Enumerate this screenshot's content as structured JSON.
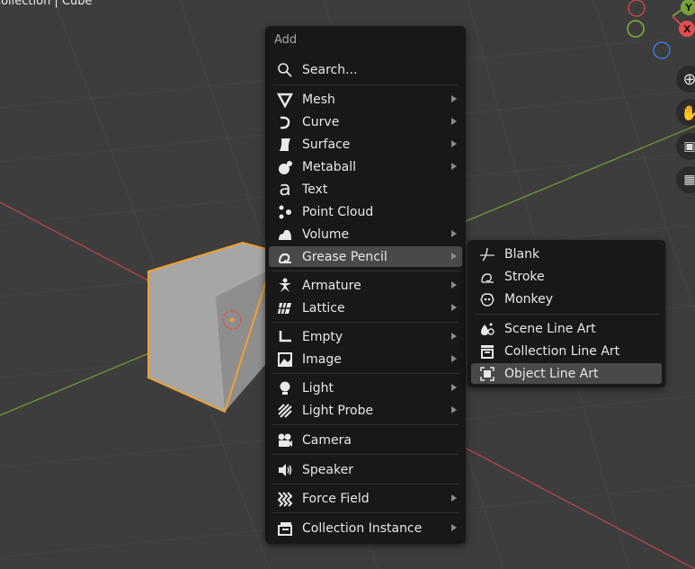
{
  "viewport": {
    "title": "Collection | Cube"
  },
  "axis_gizmo": {
    "y_label": "Y",
    "x_label": "X"
  },
  "add_menu": {
    "title": "Add",
    "search_label": "Search...",
    "items": [
      {
        "label": "Mesh",
        "icon": "mesh-cone-icon",
        "submenu": true
      },
      {
        "label": "Curve",
        "icon": "curve-icon",
        "submenu": true
      },
      {
        "label": "Surface",
        "icon": "surface-icon",
        "submenu": true
      },
      {
        "label": "Metaball",
        "icon": "metaball-icon",
        "submenu": true
      },
      {
        "label": "Text",
        "icon": "text-icon",
        "submenu": false
      },
      {
        "label": "Point Cloud",
        "icon": "point-cloud-icon",
        "submenu": false
      },
      {
        "label": "Volume",
        "icon": "volume-icon",
        "submenu": true
      },
      {
        "label": "Grease Pencil",
        "icon": "grease-pencil-icon",
        "submenu": true
      },
      {
        "label": "Armature",
        "icon": "armature-icon",
        "submenu": true
      },
      {
        "label": "Lattice",
        "icon": "lattice-icon",
        "submenu": true
      },
      {
        "label": "Empty",
        "icon": "empty-icon",
        "submenu": true
      },
      {
        "label": "Image",
        "icon": "image-icon",
        "submenu": true
      },
      {
        "label": "Light",
        "icon": "light-icon",
        "submenu": true
      },
      {
        "label": "Light Probe",
        "icon": "light-probe-icon",
        "submenu": true
      },
      {
        "label": "Camera",
        "icon": "camera-icon",
        "submenu": false
      },
      {
        "label": "Speaker",
        "icon": "speaker-icon",
        "submenu": false
      },
      {
        "label": "Force Field",
        "icon": "force-field-icon",
        "submenu": true
      },
      {
        "label": "Collection Instance",
        "icon": "collection-instance-icon",
        "submenu": true
      }
    ]
  },
  "grease_pencil_menu": {
    "items": [
      {
        "label": "Blank",
        "icon": "blank-stroke-icon"
      },
      {
        "label": "Stroke",
        "icon": "stroke-icon"
      },
      {
        "label": "Monkey",
        "icon": "monkey-icon"
      },
      {
        "label": "Scene Line Art",
        "icon": "scene-line-art-icon"
      },
      {
        "label": "Collection Line Art",
        "icon": "collection-line-art-icon"
      },
      {
        "label": "Object Line Art",
        "icon": "object-line-art-icon"
      }
    ]
  },
  "colors": {
    "menu_bg": "#181818",
    "highlight": "#494949",
    "viewport_bg": "#3d3d3d",
    "x_axis": "#e34d4d",
    "y_axis": "#79a33a",
    "z_axis": "#3f7bd9",
    "selection": "#f0a030"
  }
}
